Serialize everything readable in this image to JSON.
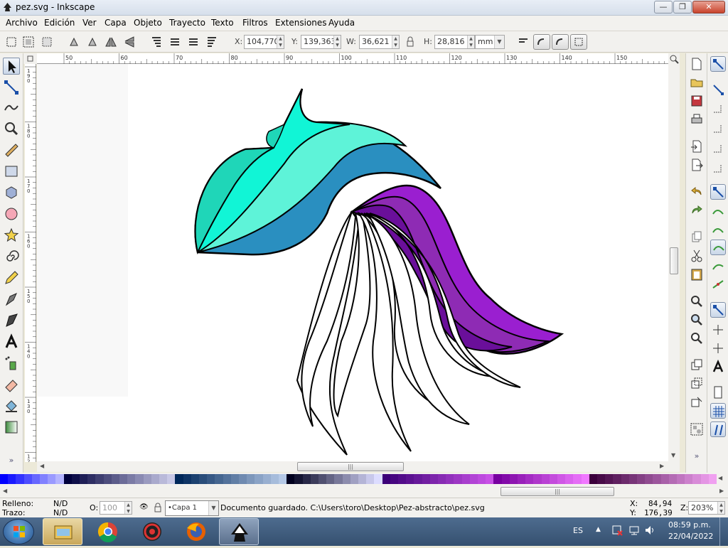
{
  "window": {
    "title": "pez.svg - Inkscape"
  },
  "menu": [
    "Archivo",
    "Edición",
    "Ver",
    "Capa",
    "Objeto",
    "Trayecto",
    "Texto",
    "Filtros",
    "Extensiones",
    "Ayuda"
  ],
  "toolbar": {
    "x_label": "X:",
    "x_value": "104,770",
    "y_label": "Y:",
    "y_value": "139,363",
    "w_label": "W:",
    "w_value": "36,621",
    "h_label": "H:",
    "h_value": "28,816",
    "unit": "mm"
  },
  "ruler_h": [
    "50",
    "60",
    "70",
    "80",
    "90",
    "100",
    "110",
    "120",
    "130",
    "140",
    "150"
  ],
  "ruler_v": [
    "190",
    "180",
    "170",
    "160",
    "150",
    "140",
    "130",
    "120"
  ],
  "status": {
    "fill_label": "Relleno:",
    "fill_value": "N/D",
    "stroke_label": "Trazo:",
    "stroke_value": "N/D",
    "opacity_label": "O:",
    "opacity_value": "100",
    "layer": "•Capa 1",
    "message": "Documento guardado. C:\\Users\\toro\\Desktop\\Pez-abstracto\\pez.svg",
    "cx_label": "X:",
    "cx_value": "84,94",
    "cy_label": "Y:",
    "cy_value": "176,39",
    "zoom_label": "Z:",
    "zoom_value": "203%"
  },
  "taskbar": {
    "lang": "ES",
    "time": "08:59 p.m.",
    "date": "22/04/2022"
  },
  "colors": {
    "teal_light": "#5ef3d8",
    "teal": "#1fd6b8",
    "aqua": "#11f5d6",
    "blue": "#2a8fc0",
    "purple": "#9a1fd0",
    "purple_mid": "#8e2bb4",
    "purple_dark": "#6a0f9a"
  },
  "icons": {
    "tools": [
      "selector-icon",
      "node-icon",
      "tweak-icon",
      "zoom-icon",
      "measure-icon",
      "rect-icon",
      "box3d-icon",
      "ellipse-icon",
      "star-icon",
      "spiral-icon",
      "pencil-icon",
      "pen-icon",
      "calligraphy-icon",
      "text-icon",
      "spray-icon",
      "eraser-icon",
      "bucket-icon",
      "gradient-icon"
    ]
  }
}
